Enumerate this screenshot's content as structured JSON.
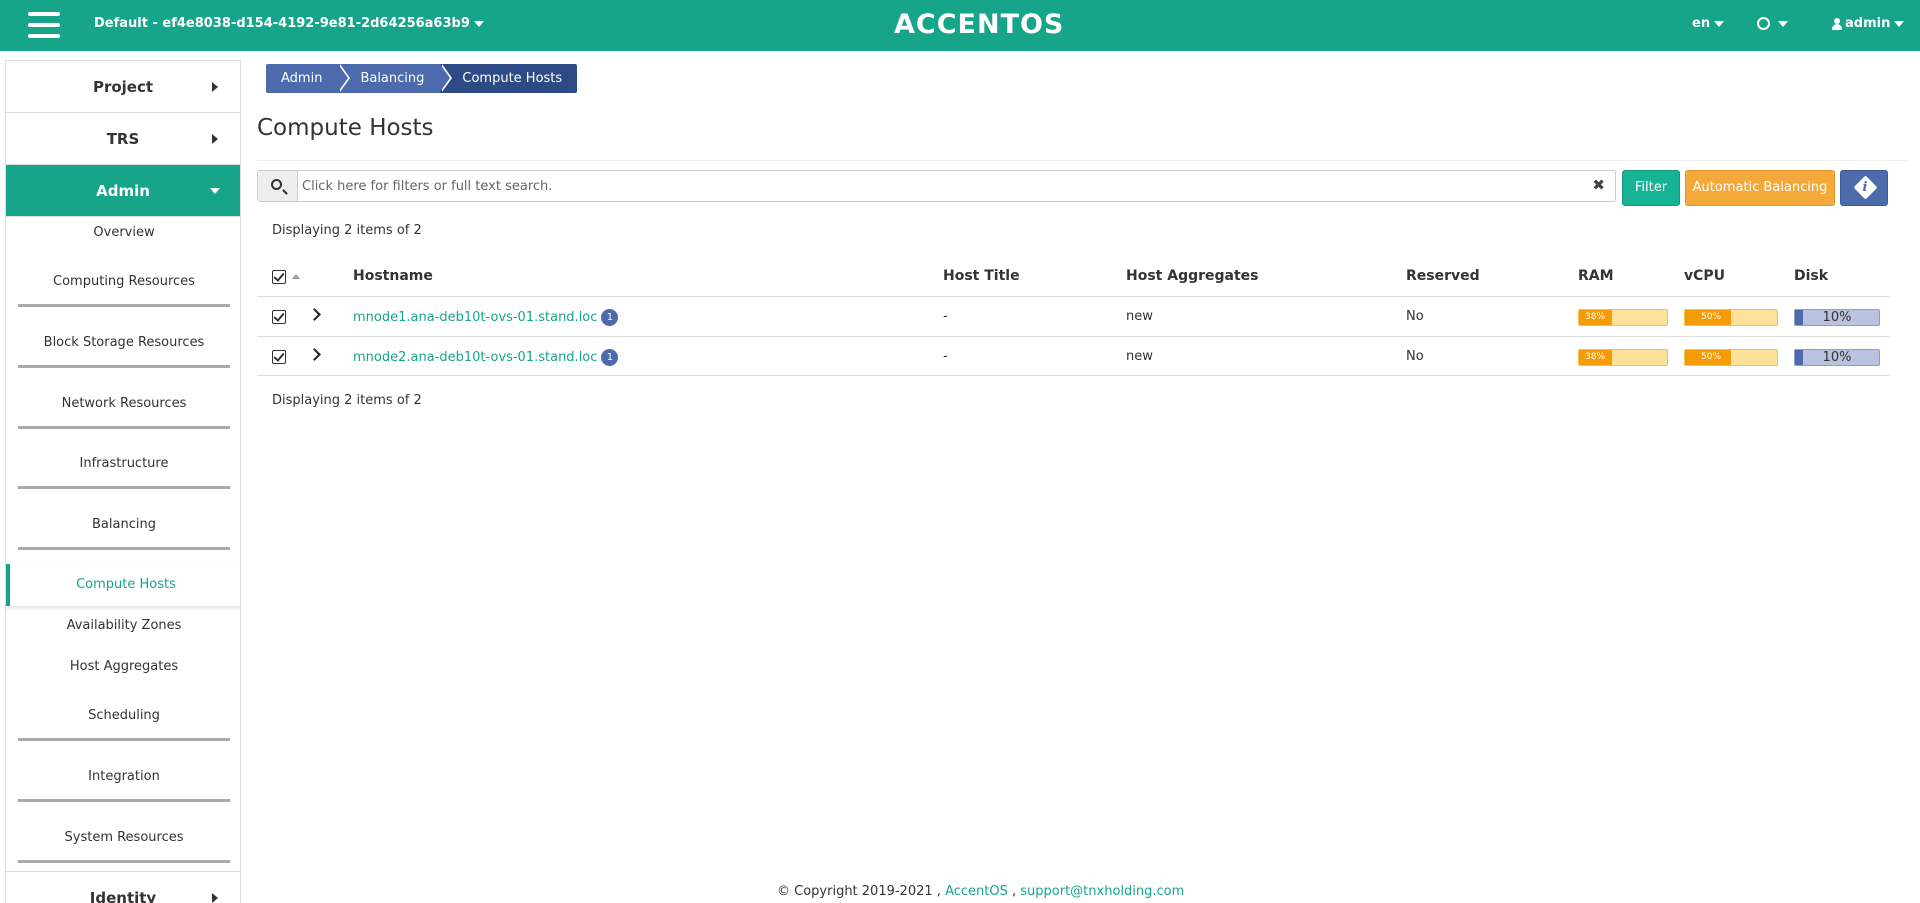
{
  "topbar": {
    "project": "Default - ef4e8038-d154-4192-9e81-2d64256a63b9",
    "logo": "ACCENTOS",
    "language": "en",
    "user": "admin"
  },
  "sidebar": {
    "sections": {
      "project": "Project",
      "trs": "TRS",
      "admin": "Admin",
      "identity": "Identity"
    },
    "items": [
      "Overview",
      "Computing Resources",
      "Block Storage Resources",
      "Network Resources",
      "Infrastructure",
      "Balancing",
      "Compute Hosts",
      "Availability Zones",
      "Host Aggregates",
      "Scheduling",
      "Integration",
      "System Resources"
    ]
  },
  "breadcrumb": [
    "Admin",
    "Balancing",
    "Compute Hosts"
  ],
  "page_title": "Compute Hosts",
  "search": {
    "placeholder": "Click here for filters or full text search."
  },
  "buttons": {
    "filter": "Filter",
    "auto_balancing": "Automatic Balancing"
  },
  "count_text": "Displaying 2 items of 2",
  "table": {
    "columns": [
      "Hostname",
      "Host Title",
      "Host Aggregates",
      "Reserved",
      "RAM",
      "vCPU",
      "Disk"
    ],
    "rows": [
      {
        "hostname": "mnode1.ana-deb10t-ovs-01.stand.loc",
        "badge": "1",
        "title": "-",
        "aggregates": "new",
        "reserved": "No",
        "ram": "38%",
        "ram_value": 38,
        "vcpu": "50%",
        "vcpu_value": 50,
        "disk": "10%",
        "disk_value": 10
      },
      {
        "hostname": "mnode2.ana-deb10t-ovs-01.stand.loc",
        "badge": "1",
        "title": "-",
        "aggregates": "new",
        "reserved": "No",
        "ram": "38%",
        "ram_value": 38,
        "vcpu": "50%",
        "vcpu_value": 50,
        "disk": "10%",
        "disk_value": 10
      }
    ]
  },
  "footer": {
    "copyright": "© Copyright 2019-2021 ,",
    "brand": "AccentOS",
    "sep": ",",
    "email": "support@tnxholding.com"
  },
  "colors": {
    "primary": "#17a589",
    "breadcrumb": "#4d6bac",
    "warning": "#f5a93a"
  }
}
